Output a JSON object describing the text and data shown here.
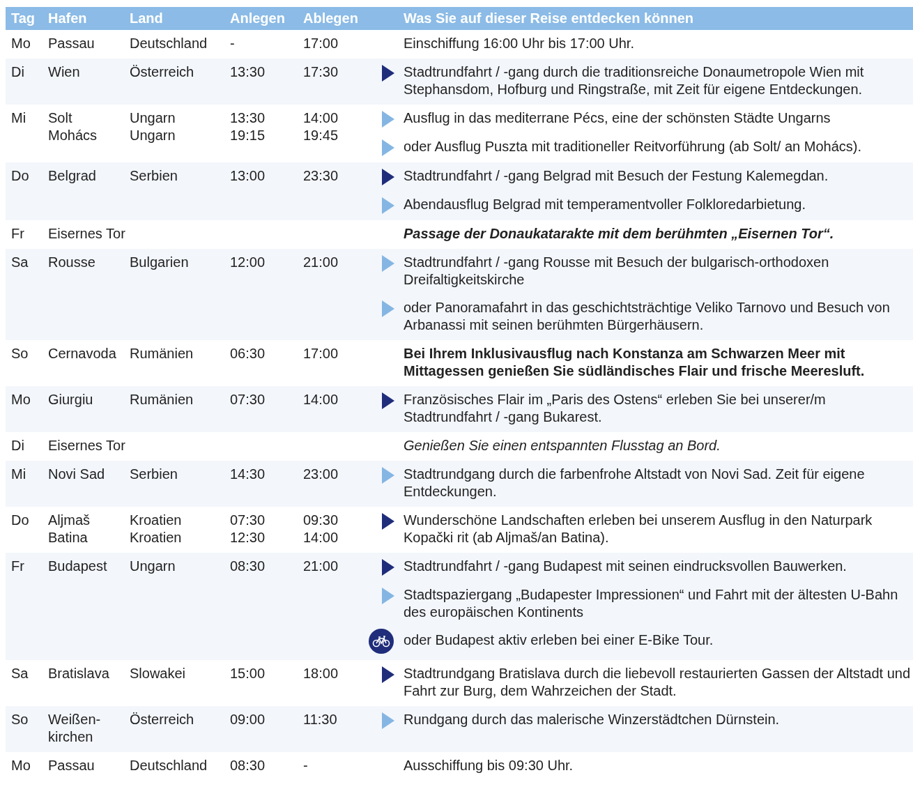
{
  "table": {
    "columns": [
      "Tag",
      "Hafen",
      "Land",
      "Anlegen",
      "Ablegen",
      "Was Sie auf dieser Reise entdecken können"
    ],
    "rows": [
      {
        "day": "Mo",
        "stops": [
          {
            "port": "Passau",
            "country": "Deutschland",
            "arrive": "-",
            "depart": "17:00"
          }
        ],
        "activities": [
          {
            "kind": "plain",
            "bold": false,
            "italic": false,
            "text": "Einschiffung 16:00 Uhr bis 17:00 Uhr."
          }
        ]
      },
      {
        "day": "Di",
        "stops": [
          {
            "port": "Wien",
            "country": "Österreich",
            "arrive": "13:30",
            "depart": "17:30"
          }
        ],
        "activities": [
          {
            "kind": "included",
            "bold": false,
            "italic": false,
            "text": "Stadtrundfahrt / -gang durch die traditionsreiche Donaumetropole Wien mit Stephansdom, Hofburg und Ringstraße, mit Zeit für eigene Entdeckungen."
          }
        ]
      },
      {
        "day": "Mi",
        "stops": [
          {
            "port": "Solt",
            "country": "Ungarn",
            "arrive": "13:30",
            "depart": "14:00"
          },
          {
            "port": "Mohács",
            "country": "Ungarn",
            "arrive": "19:15",
            "depart": "19:45"
          }
        ],
        "activities": [
          {
            "kind": "optional",
            "bold": false,
            "italic": false,
            "text": "Ausflug in das mediterrane Pécs, eine der schönsten Städte Ungarns"
          },
          {
            "kind": "optional",
            "bold": false,
            "italic": false,
            "text": "oder Ausflug Puszta mit traditioneller Reitvorführung (ab Solt/ an Mohács)."
          }
        ]
      },
      {
        "day": "Do",
        "stops": [
          {
            "port": "Belgrad",
            "country": "Serbien",
            "arrive": "13:00",
            "depart": "23:30"
          }
        ],
        "activities": [
          {
            "kind": "included",
            "bold": false,
            "italic": false,
            "text": "Stadtrundfahrt / -gang Belgrad mit Besuch der Festung Kalemegdan."
          },
          {
            "kind": "optional",
            "bold": false,
            "italic": false,
            "text": "Abendausflug Belgrad mit temperamentvoller Folkloredarbietung."
          }
        ]
      },
      {
        "day": "Fr",
        "stops": [
          {
            "port": "Eisernes Tor"
          }
        ],
        "activities": [
          {
            "kind": "plain",
            "bold": true,
            "italic": true,
            "text": "Passage der Donaukatarakte mit dem berühmten „Eisernen Tor“."
          }
        ]
      },
      {
        "day": "Sa",
        "stops": [
          {
            "port": "Rousse",
            "country": "Bulgarien",
            "arrive": "12:00",
            "depart": "21:00"
          }
        ],
        "activities": [
          {
            "kind": "optional",
            "bold": false,
            "italic": false,
            "text": "Stadtrundfahrt / -gang Rousse mit Besuch der bulgarisch-orthodoxen Dreifaltigkeitskirche"
          },
          {
            "kind": "optional",
            "bold": false,
            "italic": false,
            "text": "oder Panoramafahrt in das geschichtsträchtige Veliko Tarnovo und Besuch von Arbanassi mit seinen berühmten Bürgerhäusern."
          }
        ]
      },
      {
        "day": "So",
        "stops": [
          {
            "port": "Cernavoda",
            "country": "Rumänien",
            "arrive": "06:30",
            "depart": "17:00"
          }
        ],
        "activities": [
          {
            "kind": "plain",
            "bold": true,
            "italic": false,
            "text": "Bei Ihrem Inklusivausflug nach Konstanza am Schwarzen Meer mit Mittagessen genießen Sie südländisches Flair und frische Meeresluft."
          }
        ]
      },
      {
        "day": "Mo",
        "stops": [
          {
            "port": "Giurgiu",
            "country": "Rumänien",
            "arrive": "07:30",
            "depart": "14:00"
          }
        ],
        "activities": [
          {
            "kind": "included",
            "bold": false,
            "italic": false,
            "text": "Französisches Flair im „Paris des Ostens“ erleben Sie bei unserer/m Stadtrundfahrt / -gang Bukarest."
          }
        ]
      },
      {
        "day": "Di",
        "stops": [
          {
            "port": "Eisernes Tor"
          }
        ],
        "activities": [
          {
            "kind": "plain",
            "bold": false,
            "italic": true,
            "text": "Genießen Sie einen entspannten Flusstag an Bord."
          }
        ]
      },
      {
        "day": "Mi",
        "stops": [
          {
            "port": "Novi Sad",
            "country": "Serbien",
            "arrive": "14:30",
            "depart": "23:00"
          }
        ],
        "activities": [
          {
            "kind": "optional",
            "bold": false,
            "italic": false,
            "text": "Stadtrundgang durch die farbenfrohe Altstadt von Novi Sad. Zeit für eigene Entdeckungen."
          }
        ]
      },
      {
        "day": "Do",
        "stops": [
          {
            "port": "Aljmaš",
            "country": "Kroatien",
            "arrive": "07:30",
            "depart": "09:30"
          },
          {
            "port": "Batina",
            "country": "Kroatien",
            "arrive": "12:30",
            "depart": "14:00"
          }
        ],
        "activities": [
          {
            "kind": "included",
            "bold": false,
            "italic": false,
            "text": "Wunderschöne Landschaften erleben bei unserem Ausflug in den Naturpark Kopački rit (ab Aljmaš/an Batina)."
          }
        ]
      },
      {
        "day": "Fr",
        "stops": [
          {
            "port": "Budapest",
            "country": "Ungarn",
            "arrive": "08:30",
            "depart": "21:00"
          }
        ],
        "activities": [
          {
            "kind": "included",
            "bold": false,
            "italic": false,
            "text": "Stadtrundfahrt / -gang Budapest mit seinen eindrucksvollen Bauwerken."
          },
          {
            "kind": "optional",
            "bold": false,
            "italic": false,
            "text": "Stadtspaziergang „Budapester Impressionen“ und Fahrt mit der ältesten U-Bahn des europäischen Kontinents"
          },
          {
            "kind": "bike",
            "bold": false,
            "italic": false,
            "text": "oder Budapest aktiv erleben bei einer E-Bike Tour."
          }
        ]
      },
      {
        "day": "Sa",
        "stops": [
          {
            "port": "Bratislava",
            "country": "Slowakei",
            "arrive": "15:00",
            "depart": "18:00"
          }
        ],
        "activities": [
          {
            "kind": "included",
            "bold": false,
            "italic": false,
            "text": "Stadtrundgang Bratislava durch die liebevoll restaurierten Gassen der Altstadt und Fahrt zur Burg, dem Wahrzeichen der Stadt."
          }
        ]
      },
      {
        "day": "So",
        "stops": [
          {
            "port": "Weißen- kirchen",
            "country": "Österreich",
            "arrive": "09:00",
            "depart": "11:30"
          }
        ],
        "activities": [
          {
            "kind": "optional",
            "bold": false,
            "italic": false,
            "text": "Rundgang durch das malerische Winzerstädtchen Dürnstein."
          }
        ]
      },
      {
        "day": "Mo",
        "stops": [
          {
            "port": "Passau",
            "country": "Deutschland",
            "arrive": "08:30",
            "depart": "-"
          }
        ],
        "activities": [
          {
            "kind": "plain",
            "bold": false,
            "italic": false,
            "text": "Ausschiffung bis 09:30 Uhr."
          }
        ]
      }
    ]
  }
}
